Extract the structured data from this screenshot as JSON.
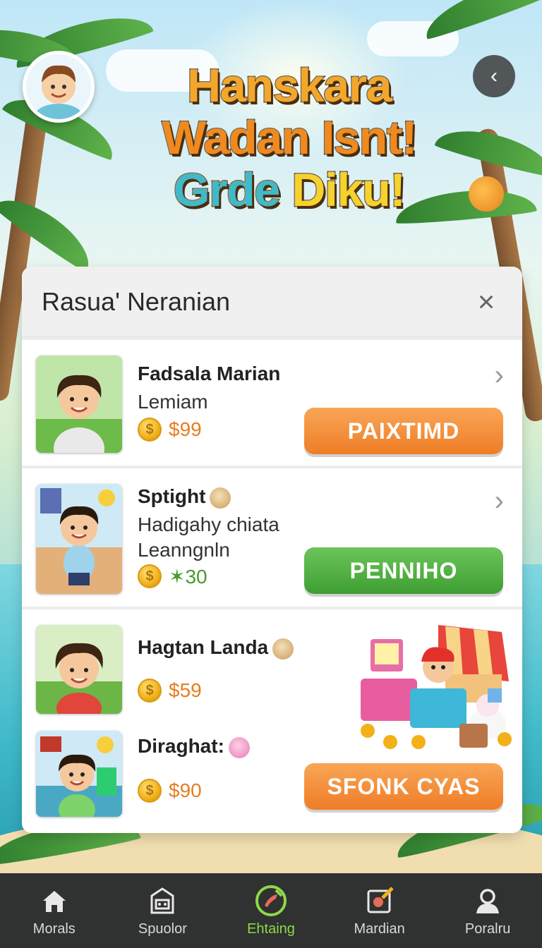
{
  "header": {
    "title_line1": "Hanskara",
    "title_line2": "Wadan Isnt!",
    "title_line3_a": "Grde ",
    "title_line3_b": "Diku!",
    "close_glyph": "‹"
  },
  "panel": {
    "title": "Rasua' Neranian",
    "close_glyph": "×"
  },
  "cards": [
    {
      "name": "Fadsala Marian",
      "sub": "Lemiam",
      "price": "$99",
      "button": "PAIXTIMD",
      "button_color": "#ef7d26"
    },
    {
      "name": "Sptight",
      "sub1": "Hadigahy chiata",
      "sub2": "Leanngnln",
      "price": "✶30",
      "button": "PENNIHO",
      "button_color": "#3e9e32"
    },
    {
      "name": "Hagtan Landa",
      "price": "$59"
    },
    {
      "name": "Diraghat:",
      "price": "$90",
      "button": "SFONK CYAS",
      "button_color": "#ef7d26"
    }
  ],
  "nav": [
    {
      "label": "Morals",
      "icon": "home-icon",
      "active": false
    },
    {
      "label": "Spuolor",
      "icon": "shop-icon",
      "active": false
    },
    {
      "label": "Ehtaing",
      "icon": "craft-icon",
      "active": true
    },
    {
      "label": "Mardian",
      "icon": "calendar-tools-icon",
      "active": false
    },
    {
      "label": "Poralru",
      "icon": "profile-icon",
      "active": false
    }
  ],
  "colors": {
    "accent_orange": "#ef7d26",
    "accent_green": "#3e9e32",
    "nav_active": "#8cd94a",
    "nav_bg": "#303131"
  }
}
